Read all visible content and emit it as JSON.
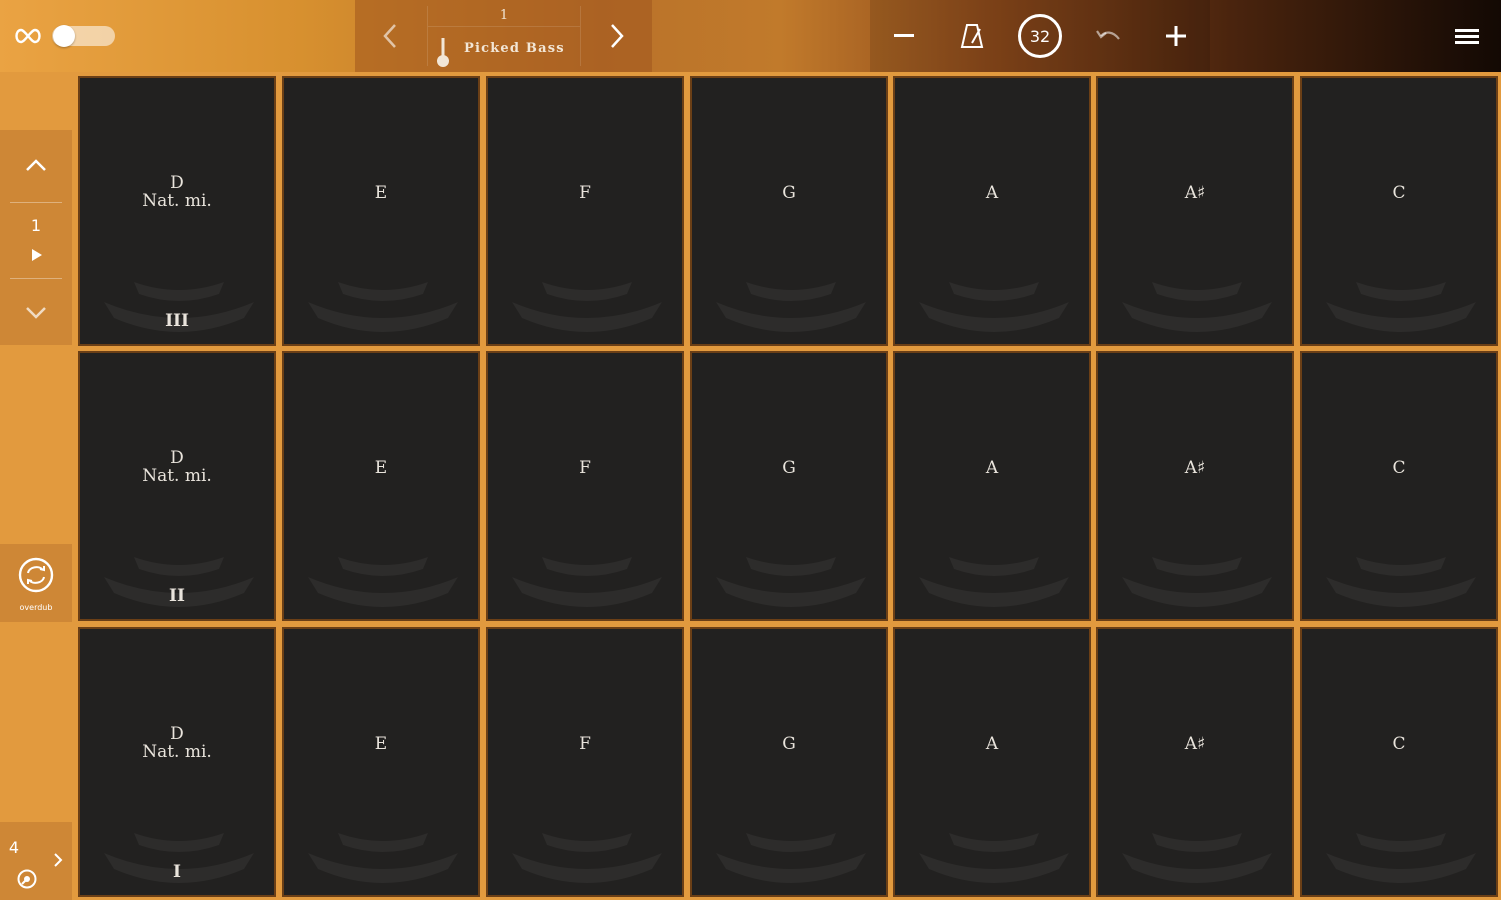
{
  "topbar": {
    "instrument_number": "1",
    "instrument_name": "Picked Bass",
    "tempo": "32"
  },
  "sidebar": {
    "row_indicator": "1",
    "overdub_label": "overdub",
    "page_number": "4"
  },
  "pads": {
    "rows": [
      {
        "roman": "III",
        "cells": [
          {
            "note": "D",
            "quality": "Nat. mi."
          },
          {
            "note": "E"
          },
          {
            "note": "F"
          },
          {
            "note": "G"
          },
          {
            "note": "A"
          },
          {
            "note": "A♯"
          },
          {
            "note": "C"
          }
        ]
      },
      {
        "roman": "II",
        "cells": [
          {
            "note": "D",
            "quality": "Nat. mi."
          },
          {
            "note": "E"
          },
          {
            "note": "F"
          },
          {
            "note": "G"
          },
          {
            "note": "A"
          },
          {
            "note": "A♯"
          },
          {
            "note": "C"
          }
        ]
      },
      {
        "roman": "I",
        "cells": [
          {
            "note": "D",
            "quality": "Nat. mi."
          },
          {
            "note": "E"
          },
          {
            "note": "F"
          },
          {
            "note": "G"
          },
          {
            "note": "A"
          },
          {
            "note": "A♯"
          },
          {
            "note": "C"
          }
        ]
      }
    ]
  },
  "icons": {
    "loop": "infinity-icon",
    "prev": "chevron-left-icon",
    "next": "chevron-right-icon",
    "instrument": "guitar-icon",
    "minus": "minus-icon",
    "metronome": "metronome-icon",
    "undo": "undo-icon",
    "plus": "plus-icon",
    "menu": "menu-icon",
    "up": "chevron-up-icon",
    "play": "play-icon",
    "down": "chevron-down-icon",
    "overdub": "overdub-icon",
    "page_next": "chevron-right-icon",
    "settings": "dial-icon"
  },
  "colors": {
    "pad_background": "#222120",
    "pad_border": "#6b3f16",
    "accent_orange": "#e29a3e"
  }
}
